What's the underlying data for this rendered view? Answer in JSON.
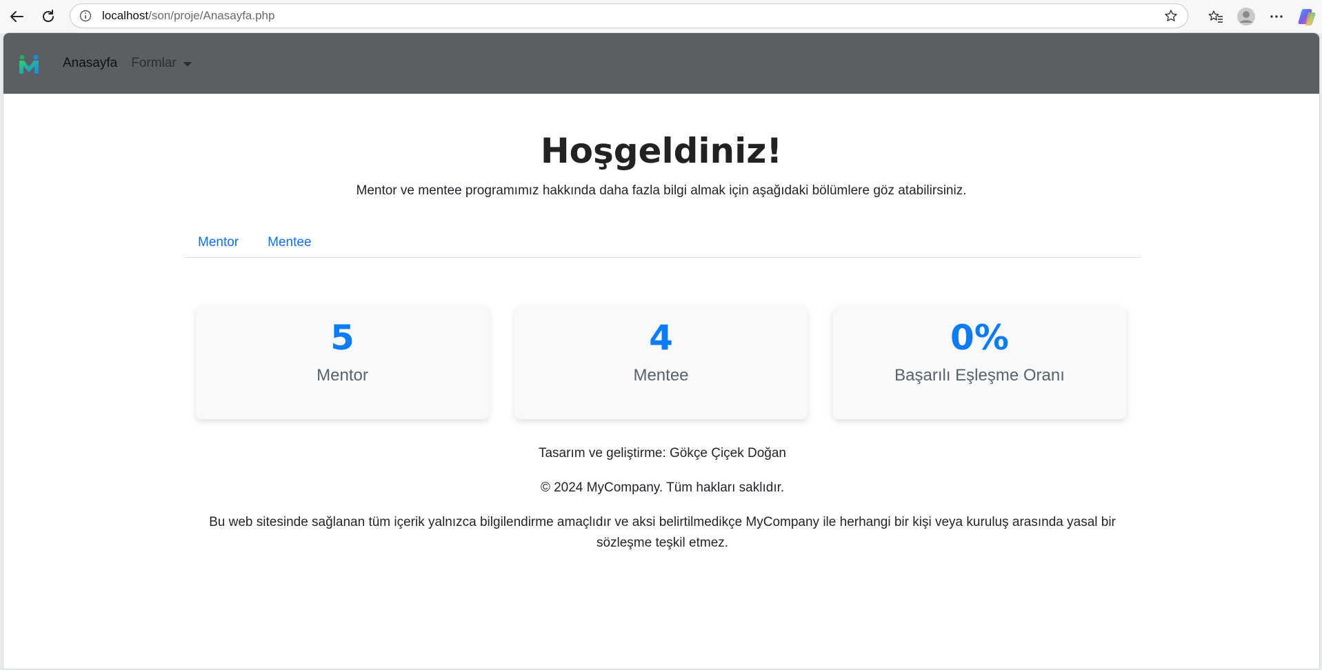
{
  "browser": {
    "url_host": "localhost",
    "url_path": "/son/proje/Anasayfa.php"
  },
  "navbar": {
    "home_label": "Anasayfa",
    "dropdown_label": "Formlar"
  },
  "hero": {
    "title": "Hoşgeldiniz!",
    "subtitle": "Mentor ve mentee programımız hakkında daha fazla bilgi almak için aşağıdaki bölümlere göz atabilirsiniz."
  },
  "tabs": [
    {
      "label": "Mentor"
    },
    {
      "label": "Mentee"
    }
  ],
  "stats": [
    {
      "value": "5",
      "label": "Mentor"
    },
    {
      "value": "4",
      "label": "Mentee"
    },
    {
      "value": "0%",
      "label": "Başarılı Eşleşme Oranı"
    }
  ],
  "footer": {
    "credit": "Tasarım ve geliştirme: Gökçe Çiçek Doğan",
    "copyright": "© 2024 MyCompany. Tüm hakları saklıdır.",
    "disclaimer": "Bu web sitesinde sağlanan tüm içerik yalnızca bilgilendirme amaçlıdır ve aksi belirtilmedikçe MyCompany ile herhangi bir kişi veya kuruluş arasında yasal bir sözleşme teşkil etmez."
  },
  "colors": {
    "navbar_bg": "#5b5f63",
    "accent": "#0d6efd",
    "stat_value": "#0d7bf2"
  }
}
